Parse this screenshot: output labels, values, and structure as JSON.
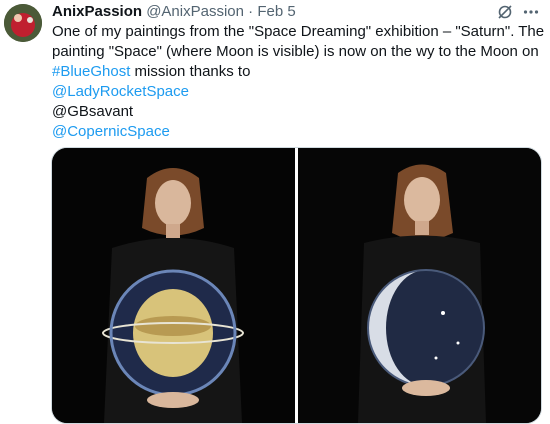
{
  "tweet": {
    "author_name": "AnixPassion",
    "author_handle": "@AnixPassion",
    "separator": "·",
    "date": "Feb 5",
    "text_line1": "One of my paintings from the \"Space Dreaming\" exhibition – \"Saturn\". The",
    "text_line2": "painting \"Space\" (where Moon is visible) is now on the wy to the Moon on",
    "hashtag": "#BlueGhost",
    "text_line3_rest": " mission thanks to",
    "mention1": "@LadyRocketSpace",
    "mention2": "@GBsavant",
    "mention3": "@CopernicSpace"
  },
  "icons": {
    "grok": "grok-icon",
    "more": "more-icon"
  },
  "colors": {
    "text": "#0f1419",
    "secondary": "#536471",
    "link": "#1d9bf0"
  }
}
